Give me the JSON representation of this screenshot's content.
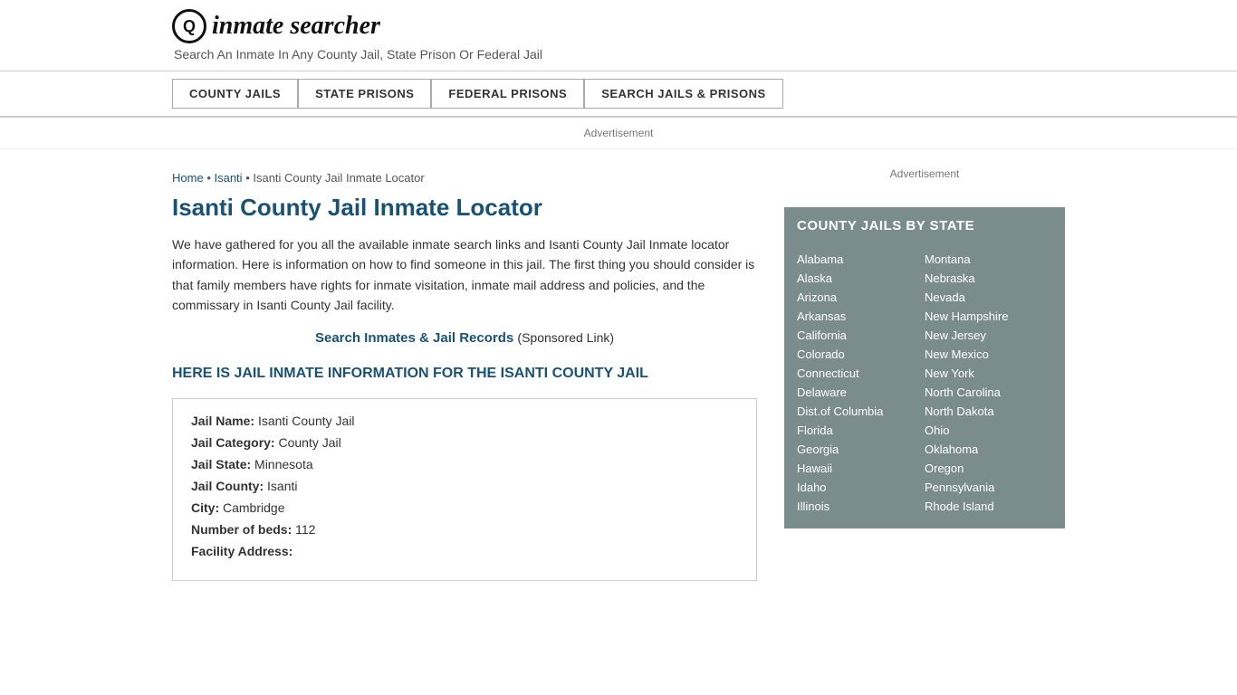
{
  "header": {
    "logo_icon": "🔍",
    "logo_text_plain": "inmate",
    "logo_text_italic": "searcher",
    "tagline": "Search An Inmate In Any County Jail, State Prison Or Federal Jail"
  },
  "nav": {
    "items": [
      {
        "id": "county-jails",
        "label": "COUNTY JAILS"
      },
      {
        "id": "state-prisons",
        "label": "STATE PRISONS"
      },
      {
        "id": "federal-prisons",
        "label": "FEDERAL PRISONS"
      },
      {
        "id": "search-jails",
        "label": "SEARCH JAILS & PRISONS"
      }
    ]
  },
  "ad_label": "Advertisement",
  "breadcrumb": {
    "home": "Home",
    "separator": " • ",
    "isanti": "Isanti",
    "current": "Isanti County Jail Inmate Locator"
  },
  "page_title": "Isanti County Jail Inmate Locator",
  "body_text": "We have gathered for you all the available inmate search links and Isanti County Jail Inmate locator information. Here is information on how to find someone in this jail. The first thing you should consider is that family members have rights for inmate visitation, inmate mail address and policies, and the commissary in Isanti County Jail facility.",
  "sponsored": {
    "link_text": "Search Inmates & Jail Records",
    "suffix": " (Sponsored Link)"
  },
  "section_heading": "HERE IS JAIL INMATE INFORMATION FOR THE ISANTI COUNTY JAIL",
  "info_box": {
    "fields": [
      {
        "label": "Jail Name:",
        "value": "Isanti County Jail"
      },
      {
        "label": "Jail Category:",
        "value": "County Jail"
      },
      {
        "label": "Jail State:",
        "value": "Minnesota"
      },
      {
        "label": "Jail County:",
        "value": "Isanti"
      },
      {
        "label": "City:",
        "value": "Cambridge"
      },
      {
        "label": "Number of beds:",
        "value": "112"
      },
      {
        "label": "Facility Address:",
        "value": ""
      }
    ]
  },
  "sidebar": {
    "ad_label": "Advertisement",
    "county_jails_title": "COUNTY JAILS BY STATE",
    "states_col1": [
      "Alabama",
      "Alaska",
      "Arizona",
      "Arkansas",
      "California",
      "Colorado",
      "Connecticut",
      "Delaware",
      "Dist.of Columbia",
      "Florida",
      "Georgia",
      "Hawaii",
      "Idaho",
      "Illinois"
    ],
    "states_col2": [
      "Montana",
      "Nebraska",
      "Nevada",
      "New Hampshire",
      "New Jersey",
      "New Mexico",
      "New York",
      "North Carolina",
      "North Dakota",
      "Ohio",
      "Oklahoma",
      "Oregon",
      "Pennsylvania",
      "Rhode Island"
    ]
  }
}
